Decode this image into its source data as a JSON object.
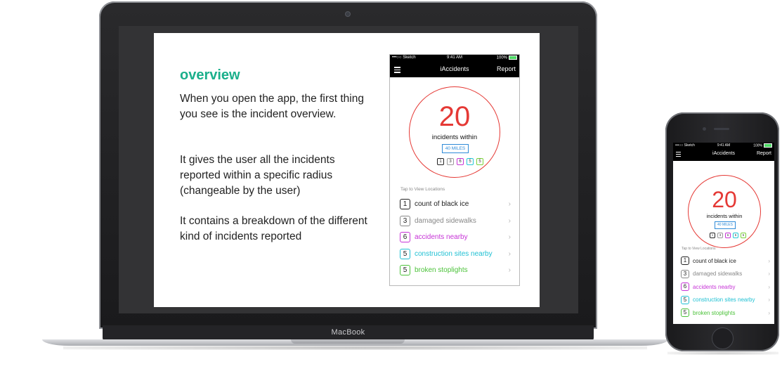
{
  "laptop": {
    "brand_label": "MacBook"
  },
  "slide": {
    "title": "overview",
    "paragraphs": [
      "When you open the app, the first thing you see is the incident overview.",
      "It gives the user all the incidents reported within a specific radius (changeable by the user)",
      "It contains a breakdown of the different kind of incidents reported"
    ],
    "title_color": "#1aaf8b"
  },
  "app": {
    "status": {
      "carrier": "•••○○ Sketch",
      "time": "9:41 AM",
      "battery": "100%"
    },
    "nav": {
      "title": "iAccidents",
      "report_label": "Report",
      "menu_icon": "hamburger-icon"
    },
    "overview": {
      "count": "20",
      "within_label": "incidents within",
      "radius_label": "40 MILES",
      "accent_color": "#e53935",
      "radius_color": "#2e8bd8"
    },
    "chips": [
      {
        "value": "1",
        "color": "#222222"
      },
      {
        "value": "3",
        "color": "#999999"
      },
      {
        "value": "6",
        "color": "#c633d6"
      },
      {
        "value": "5",
        "color": "#24c6d6"
      },
      {
        "value": "5",
        "color": "#7bd13b"
      }
    ],
    "tap_label": "Tap to View Locations",
    "incidents": [
      {
        "count": "1",
        "label": "count of black ice",
        "color": "#222222"
      },
      {
        "count": "3",
        "label": "damaged sidewalks",
        "color": "#888888"
      },
      {
        "count": "6",
        "label": "accidents nearby",
        "color": "#c633d6"
      },
      {
        "count": "5",
        "label": "construction sites nearby",
        "color": "#1fc0d3"
      },
      {
        "count": "5",
        "label": "broken stoplights",
        "color": "#4cc23a"
      }
    ],
    "chevron": "›"
  }
}
